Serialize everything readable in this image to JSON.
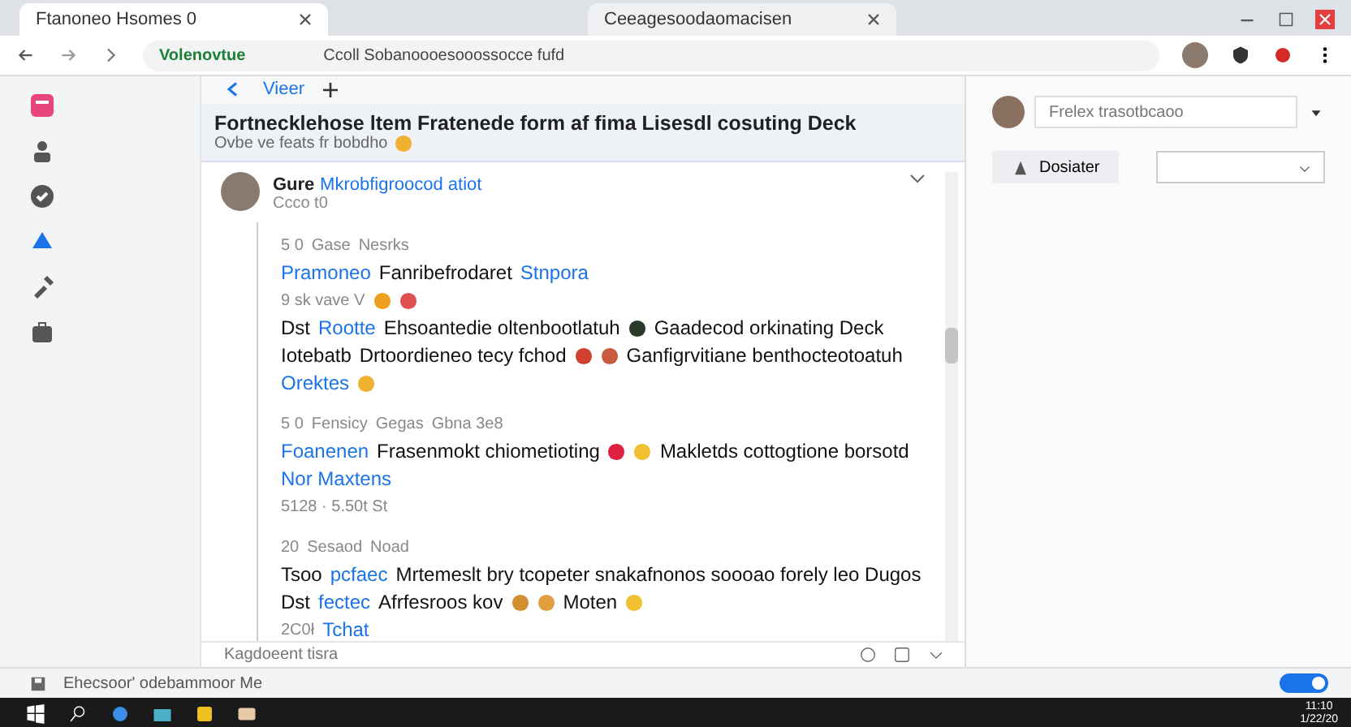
{
  "browser": {
    "tabs": [
      {
        "title": "Ftanoneo Hsomes 0",
        "selected": true
      },
      {
        "title": "Ceeagesoodaomacisen",
        "selected": false
      }
    ],
    "address": {
      "site": "Volenovtue",
      "url": "Ccoll Sobanoooesooossocce fufd"
    }
  },
  "rail": [
    {
      "kind": "note",
      "selected": false
    },
    {
      "kind": "people",
      "selected": false
    },
    {
      "kind": "check",
      "selected": false
    },
    {
      "kind": "chat",
      "selected": true
    },
    {
      "kind": "tools",
      "selected": false
    },
    {
      "kind": "bag",
      "selected": false
    }
  ],
  "view": {
    "tab": "Vieer"
  },
  "thread": {
    "title": "Fortnecklehose ltem Fratenede form af fima Lisesdl cosuting Deck",
    "subtitle": "Ovbe ve feats  fr bobdho",
    "post": {
      "author": "Gure",
      "meta": "Mkrobfigroocod atiot",
      "time": "Ccco  t0"
    },
    "lines": [
      {
        "kind": "meta",
        "segments": [
          {
            "kind": "muted",
            "text": "5 0"
          },
          {
            "kind": "muted",
            "text": "Gase"
          },
          {
            "kind": "muted",
            "text": "Nesrks"
          }
        ]
      },
      {
        "kind": "line",
        "segments": [
          {
            "kind": "link",
            "text": "Pramoneo"
          },
          {
            "kind": "text",
            "text": "Fanribefrodaret"
          },
          {
            "kind": "link",
            "text": "Stnpora"
          }
        ]
      },
      {
        "kind": "line",
        "segments": [
          {
            "kind": "muted",
            "text": "9 sk vave V"
          },
          {
            "kind": "emoji",
            "color": "#f0a020"
          },
          {
            "kind": "emoji",
            "color": "#e05050"
          }
        ]
      },
      {
        "kind": "line",
        "segments": [
          {
            "kind": "text",
            "text": "Dst"
          },
          {
            "kind": "link",
            "text": "Rootte"
          },
          {
            "kind": "text",
            "text": "Ehsoantedie oltenbootlatuh"
          },
          {
            "kind": "emoji",
            "color": "#2a3a2a"
          },
          {
            "kind": "text",
            "text": "Gaadecod orkinating Deck"
          }
        ]
      },
      {
        "kind": "line",
        "segments": [
          {
            "kind": "text",
            "text": "Iotebatb"
          },
          {
            "kind": "text",
            "text": "Drtoordieneo tecy fchod"
          },
          {
            "kind": "emoji",
            "color": "#d04030"
          },
          {
            "kind": "emoji",
            "color": "#c85a40"
          },
          {
            "kind": "text",
            "text": "Ganfigrvitiane benthocteotoatuh"
          }
        ]
      },
      {
        "kind": "line",
        "segments": [
          {
            "kind": "link",
            "text": "Orektes"
          },
          {
            "kind": "emoji",
            "color": "#f0b030"
          }
        ]
      },
      {
        "kind": "meta",
        "segments": [
          {
            "kind": "muted",
            "text": "5 0"
          },
          {
            "kind": "muted",
            "text": "Fensicy"
          },
          {
            "kind": "muted",
            "text": "Gegas"
          },
          {
            "kind": "muted",
            "text": "Gbna 3e8"
          }
        ]
      },
      {
        "kind": "line",
        "segments": [
          {
            "kind": "link",
            "text": "Foanenen"
          },
          {
            "kind": "text",
            "text": "Frasenmokt chiometioting"
          },
          {
            "kind": "emoji",
            "color": "#e02040"
          },
          {
            "kind": "emoji",
            "color": "#f0c030"
          },
          {
            "kind": "text",
            "text": "Makletds cottogtione borsotd"
          }
        ]
      },
      {
        "kind": "line",
        "segments": [
          {
            "kind": "link",
            "text": "Nor Maxtens"
          }
        ]
      },
      {
        "kind": "line",
        "segments": [
          {
            "kind": "muted",
            "text": "5128 · 5.50t St"
          }
        ]
      },
      {
        "kind": "meta",
        "segments": [
          {
            "kind": "muted",
            "text": "20"
          },
          {
            "kind": "muted",
            "text": "Sesaod"
          },
          {
            "kind": "muted",
            "text": "Noad"
          }
        ]
      },
      {
        "kind": "line",
        "segments": [
          {
            "kind": "text",
            "text": "Tsoo"
          },
          {
            "kind": "link",
            "text": "pcfaec"
          },
          {
            "kind": "text",
            "text": "Mrtemeslt bry tcopeter snakafnonos soooao forely leo Dugos"
          }
        ]
      },
      {
        "kind": "line",
        "segments": [
          {
            "kind": "text",
            "text": "Dst"
          },
          {
            "kind": "link",
            "text": "fectec"
          },
          {
            "kind": "text",
            "text": "Afrfesroos kov"
          },
          {
            "kind": "emoji",
            "color": "#d09030"
          },
          {
            "kind": "emoji",
            "color": "#e0a040"
          },
          {
            "kind": "text",
            "text": "Moten"
          },
          {
            "kind": "emoji",
            "color": "#f0c030"
          }
        ]
      },
      {
        "kind": "line",
        "segments": [
          {
            "kind": "muted",
            "text": "2C0ł"
          },
          {
            "kind": "link",
            "text": "Tchat"
          }
        ]
      }
    ]
  },
  "composer": {
    "placeholder": "Kagdoeent tisra"
  },
  "side": {
    "search": {
      "placeholder": "Frelex trasotbcaoo"
    },
    "button": "Dosiater"
  },
  "status_bar": {
    "text": "Ehecsoor' odebammoor  Me",
    "toggle": true
  },
  "taskbar": {
    "time": "11:10",
    "date": "1/22/20"
  }
}
